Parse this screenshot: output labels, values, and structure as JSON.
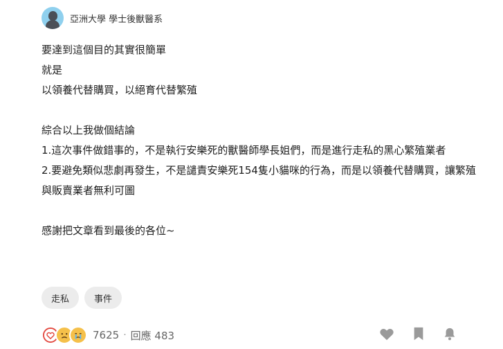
{
  "author": {
    "name": "亞洲大學 學士後獸醫系",
    "avatar_icon": "person-avatar-icon"
  },
  "content": {
    "lines": [
      "要達到這個目的其實很簡單",
      "就是",
      "以領養代替購買，以絕育代替繁殖",
      "",
      "綜合以上我做個結論",
      "1.這次事件做錯事的，不是執行安樂死的獸醫師學長姐們，而是進行走私的黑心繁殖業者",
      "2.要避免類似悲劇再發生，不是譴責安樂死154隻小貓咪的行為，而是以領養代替購買，讓繁殖與販賣業者無利可圖",
      "",
      "感謝把文章看到最後的各位~"
    ]
  },
  "tags": [
    "走私",
    "事件"
  ],
  "footer": {
    "reaction_icons": [
      "heart-icon",
      "sad-face-icon",
      "crying-face-icon"
    ],
    "reaction_count": "7625",
    "separator": "·",
    "reply_label": "回應 483",
    "action_icons": [
      "like-heart-icon",
      "bookmark-icon",
      "notification-bell-icon"
    ]
  },
  "colors": {
    "heart": "#e2453c",
    "emoji": "#f5c04a",
    "avatar_bg": "#8fd0ee",
    "icon_gray": "#9a9a9a",
    "tag_bg": "#ececec"
  }
}
